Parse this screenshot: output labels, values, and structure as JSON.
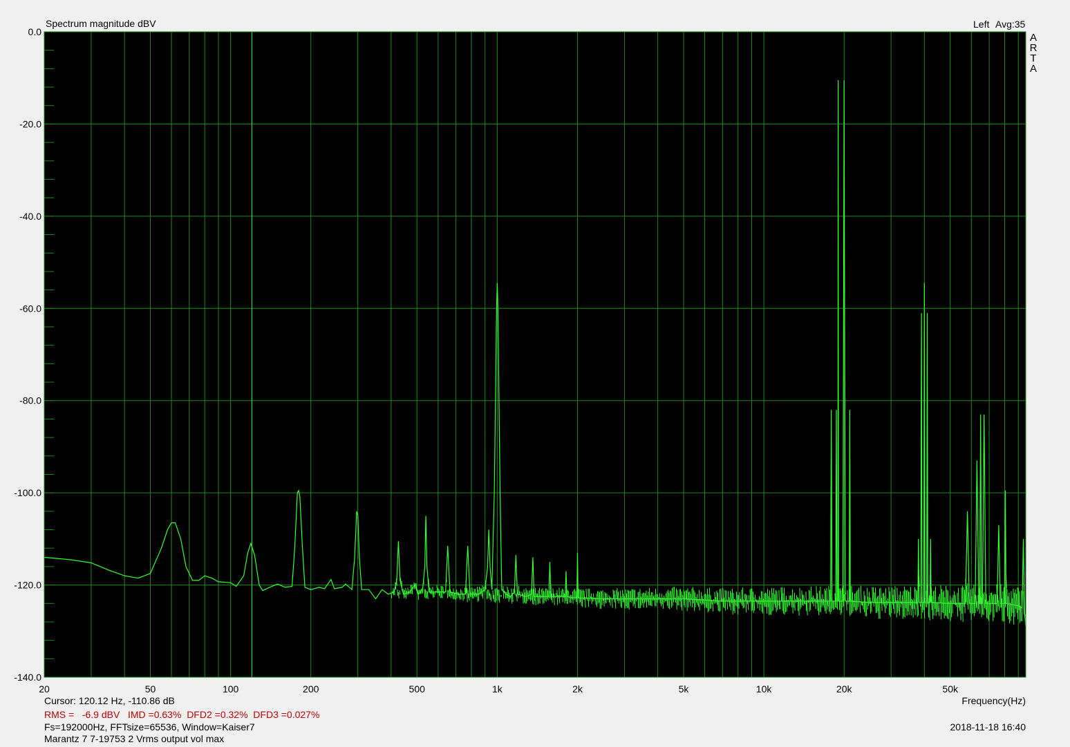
{
  "header": {
    "title": "Spectrum magnitude dBV",
    "channel": "Left",
    "avg": "Avg:35"
  },
  "brand": [
    "A",
    "R",
    "T",
    "A"
  ],
  "footer": {
    "cursor": "Cursor: 120.12 Hz, -110.86 dB",
    "measures": "RMS =   -6.9 dBV   IMD =0.63%  DFD2 =0.32%  DFD3 =0.027%",
    "settings": "Fs=192000Hz, FFTsize=65536, Window=Kaiser7",
    "device": "Marantz 7 7-19753 2 Vrms output vol max",
    "xlabel": "Frequency(Hz)",
    "date": "2018-11-18  16:40"
  },
  "colors": {
    "plot_bg": "#000000",
    "grid": "#1f8a1f",
    "trace": "#33ff33",
    "cursor_line": "#33ff33",
    "stats_text": "#c00000"
  },
  "chart_data": {
    "type": "line",
    "x_scale": "log",
    "xlim": [
      20,
      96000
    ],
    "ylim": [
      -140,
      0
    ],
    "ylabel": "Spectrum magnitude dBV",
    "xlabel": "Frequency(Hz)",
    "grid": true,
    "y_ticks": [
      "0.0",
      "-20.0",
      "-40.0",
      "-60.0",
      "-80.0",
      "-100.0",
      "-120.0",
      "-140.0"
    ],
    "x_ticks": [
      {
        "value": 20,
        "label": "20"
      },
      {
        "value": 50,
        "label": "50"
      },
      {
        "value": 100,
        "label": "100"
      },
      {
        "value": 200,
        "label": "200"
      },
      {
        "value": 500,
        "label": "500"
      },
      {
        "value": 1000,
        "label": "1k"
      },
      {
        "value": 2000,
        "label": "2k"
      },
      {
        "value": 5000,
        "label": "5k"
      },
      {
        "value": 10000,
        "label": "10k"
      },
      {
        "value": 20000,
        "label": "20k"
      },
      {
        "value": 50000,
        "label": "50k"
      }
    ],
    "cursor": {
      "x": 120.12,
      "y": -110.86
    },
    "series": [
      {
        "points": [
          [
            20,
            -114
          ],
          [
            25,
            -114.5
          ],
          [
            30,
            -115.2
          ],
          [
            35,
            -116.8
          ],
          [
            40,
            -118
          ],
          [
            45,
            -118.5
          ],
          [
            50,
            -117.5
          ],
          [
            55,
            -112
          ],
          [
            58,
            -108
          ],
          [
            60,
            -106.5
          ],
          [
            62,
            -106.5
          ],
          [
            65,
            -110
          ],
          [
            68,
            -116
          ],
          [
            72,
            -119
          ],
          [
            76,
            -119
          ],
          [
            80,
            -118
          ],
          [
            85,
            -118.5
          ],
          [
            90,
            -119.3
          ],
          [
            100,
            -119.5
          ],
          [
            105,
            -120.3
          ],
          [
            112,
            -118
          ],
          [
            116,
            -113
          ],
          [
            119,
            -111
          ],
          [
            123,
            -113.5
          ],
          [
            128,
            -120
          ],
          [
            132,
            -121.2
          ],
          [
            140,
            -120.5
          ],
          [
            150,
            -119.8
          ],
          [
            160,
            -120.5
          ],
          [
            170,
            -120.3
          ],
          [
            174,
            -112
          ],
          [
            178,
            -100
          ],
          [
            180,
            -99.5
          ],
          [
            182,
            -101
          ],
          [
            186,
            -112
          ],
          [
            190,
            -120.5
          ],
          [
            200,
            -121
          ],
          [
            215,
            -120.5
          ],
          [
            225,
            -120.8
          ],
          [
            238,
            -118.8
          ],
          [
            245,
            -120.8
          ],
          [
            262,
            -120.5
          ],
          [
            270,
            -119.8
          ],
          [
            285,
            -121
          ],
          [
            292,
            -114
          ],
          [
            297,
            -104
          ],
          [
            300,
            -105
          ],
          [
            304,
            -114
          ],
          [
            310,
            -121
          ],
          [
            330,
            -121
          ],
          [
            350,
            -123
          ],
          [
            370,
            -121
          ],
          [
            390,
            -122
          ],
          [
            410,
            -121.5
          ],
          [
            420,
            -119
          ],
          [
            426,
            -110.5
          ],
          [
            432,
            -119
          ],
          [
            445,
            -122
          ],
          [
            470,
            -121.5
          ],
          [
            490,
            -120
          ],
          [
            505,
            -122
          ],
          [
            525,
            -121
          ],
          [
            535,
            -116
          ],
          [
            540,
            -105
          ],
          [
            545,
            -116
          ],
          [
            555,
            -121.5
          ],
          [
            600,
            -121.5
          ],
          [
            640,
            -121.5
          ],
          [
            652,
            -111.5
          ],
          [
            665,
            -121.5
          ],
          [
            720,
            -122
          ],
          [
            760,
            -122
          ],
          [
            775,
            -111.5
          ],
          [
            790,
            -122
          ],
          [
            850,
            -122
          ],
          [
            900,
            -121
          ],
          [
            920,
            -116
          ],
          [
            930,
            -108
          ],
          [
            940,
            -116
          ],
          [
            955,
            -121
          ],
          [
            975,
            -100
          ],
          [
            985,
            -80
          ],
          [
            994,
            -60
          ],
          [
            1000,
            -54.5
          ],
          [
            1006,
            -60
          ],
          [
            1015,
            -80
          ],
          [
            1025,
            -100
          ],
          [
            1040,
            -121
          ],
          [
            1080,
            -122
          ],
          [
            1120,
            -122.5
          ],
          [
            1160,
            -121.5
          ],
          [
            1175,
            -113.5
          ],
          [
            1190,
            -122
          ],
          [
            1280,
            -122.5
          ],
          [
            1345,
            -122
          ],
          [
            1360,
            -114
          ],
          [
            1375,
            -122.5
          ],
          [
            1500,
            -122.5
          ],
          [
            1560,
            -122.5
          ],
          [
            1575,
            -115
          ],
          [
            1590,
            -122.5
          ],
          [
            1750,
            -122.5
          ],
          [
            1800,
            -122.5
          ],
          [
            1812,
            -117
          ],
          [
            1825,
            -122.5
          ],
          [
            1950,
            -122.8
          ],
          [
            1990,
            -122.8
          ],
          [
            2000,
            -113
          ],
          [
            2010,
            -122.8
          ],
          [
            2500,
            -123
          ],
          [
            3500,
            -123
          ],
          [
            5000,
            -123
          ],
          [
            7000,
            -123.5
          ],
          [
            10000,
            -123.5
          ],
          [
            15000,
            -123.5
          ],
          [
            17800,
            -123.5
          ],
          [
            17900,
            -82
          ],
          [
            18000,
            -123.5
          ],
          [
            18600,
            -123.5
          ],
          [
            18700,
            -82
          ],
          [
            18800,
            -123.5
          ],
          [
            18950,
            -123.5
          ],
          [
            19000,
            -10.5
          ],
          [
            19050,
            -123.5
          ],
          [
            19500,
            -123.5
          ],
          [
            19800,
            -123.5
          ],
          [
            20000,
            -10.5
          ],
          [
            20200,
            -123.5
          ],
          [
            20900,
            -123.5
          ],
          [
            21000,
            -82
          ],
          [
            21100,
            -123.5
          ],
          [
            25000,
            -123.8
          ],
          [
            35000,
            -123.8
          ],
          [
            37800,
            -123.8
          ],
          [
            38000,
            -110
          ],
          [
            38200,
            -123.8
          ],
          [
            38800,
            -123.8
          ],
          [
            39000,
            -61
          ],
          [
            39200,
            -123.8
          ],
          [
            39800,
            -123.8
          ],
          [
            40000,
            -54.5
          ],
          [
            40200,
            -123.8
          ],
          [
            40800,
            -123.8
          ],
          [
            41000,
            -61
          ],
          [
            41200,
            -123.8
          ],
          [
            42000,
            -123.8
          ],
          [
            42200,
            -110
          ],
          [
            42400,
            -123.8
          ],
          [
            50000,
            -124
          ],
          [
            57000,
            -124
          ],
          [
            58000,
            -104
          ],
          [
            59000,
            -124
          ],
          [
            62000,
            -124
          ],
          [
            63000,
            -93
          ],
          [
            64000,
            -124
          ],
          [
            64500,
            -124
          ],
          [
            65000,
            -83
          ],
          [
            65500,
            -124
          ],
          [
            66000,
            -124
          ],
          [
            67000,
            -83
          ],
          [
            68000,
            -124
          ],
          [
            75000,
            -124
          ],
          [
            76000,
            -107
          ],
          [
            77000,
            -124
          ],
          [
            80000,
            -124
          ],
          [
            80500,
            -99.5
          ],
          [
            81000,
            -124
          ],
          [
            90000,
            -124.5
          ],
          [
            93000,
            -125
          ],
          [
            94000,
            -110
          ],
          [
            95000,
            -126
          ],
          [
            96000,
            -129
          ]
        ]
      }
    ]
  }
}
